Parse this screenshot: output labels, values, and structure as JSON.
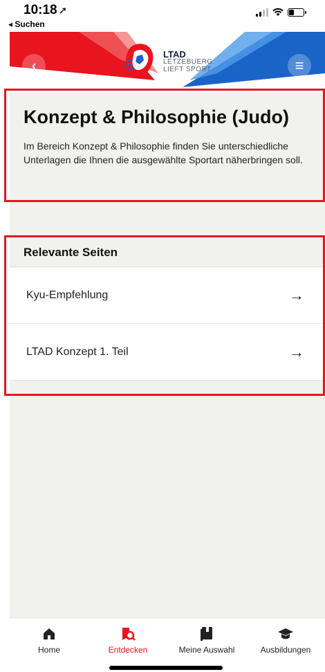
{
  "status_bar": {
    "time": "10:18",
    "location_glyph": "➚",
    "back_app": "◂ Suchen"
  },
  "header": {
    "back_icon": "‹",
    "menu_icon": "≡",
    "logo": {
      "line1": "LTAD",
      "line2": "LËTZEBUERG",
      "line3": "LIEFT SPORT"
    },
    "colors": {
      "red": "#e8141e",
      "blue": "#1a64c8"
    }
  },
  "page": {
    "title": "Konzept & Philosophie (Judo)",
    "intro": "Im Bereich Konzept & Philosophie finden Sie unterschiedliche Unterlagen die Ihnen die ausgewählte Sportart näherbringen soll."
  },
  "section": {
    "heading": "Relevante Seiten",
    "links": [
      {
        "label": "Kyu-Empfehlung",
        "icon": "arrow-right-icon"
      },
      {
        "label": "LTAD Konzept 1. Teil",
        "icon": "arrow-right-icon"
      }
    ]
  },
  "tabs": [
    {
      "label": "Home",
      "icon": "home-icon",
      "active": false
    },
    {
      "label": "Entdecken",
      "icon": "discover-icon",
      "active": true
    },
    {
      "label": "Meine Auswahl",
      "icon": "book-icon",
      "active": false
    },
    {
      "label": "Ausbildungen",
      "icon": "graduation-cap-icon",
      "active": false
    }
  ],
  "accent_color": "#e8141e"
}
